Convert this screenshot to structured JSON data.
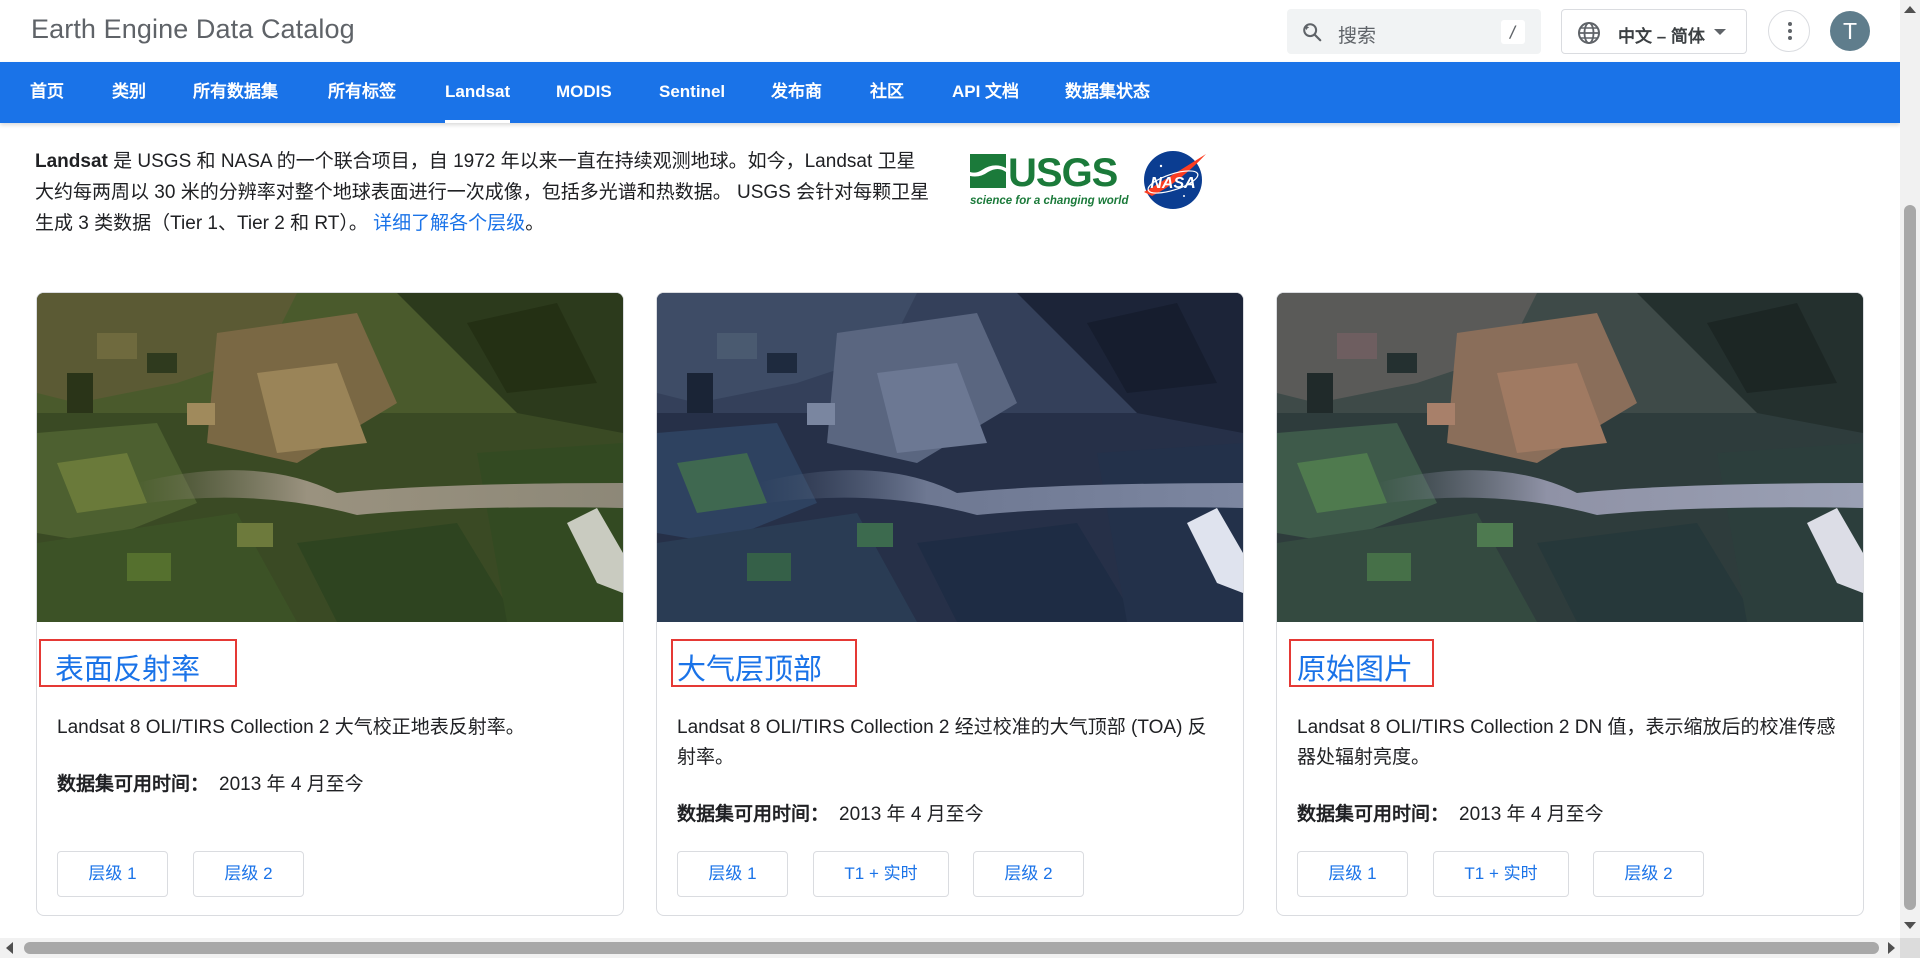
{
  "app": {
    "title": "Earth Engine Data Catalog"
  },
  "search": {
    "placeholder": "搜索",
    "shortcut": "/",
    "icon": "search-icon"
  },
  "language": {
    "label": "中文 – 简体",
    "icon": "globe-icon"
  },
  "more": {
    "icon": "more-vert-icon"
  },
  "avatar": {
    "initial": "T",
    "color": "#5f7d8c"
  },
  "nav": {
    "background": "#1a73e8",
    "tabs": [
      {
        "label": "首页",
        "active": false
      },
      {
        "label": "类别",
        "active": false
      },
      {
        "label": "所有数据集",
        "active": false
      },
      {
        "label": "所有标签",
        "active": false
      },
      {
        "label": "Landsat",
        "active": true
      },
      {
        "label": "MODIS",
        "active": false
      },
      {
        "label": "Sentinel",
        "active": false
      },
      {
        "label": "发布商",
        "active": false
      },
      {
        "label": "社区",
        "active": false
      },
      {
        "label": "API 文档",
        "active": false
      },
      {
        "label": "数据集状态",
        "active": false
      }
    ]
  },
  "intro": {
    "bold": "Landsat",
    "text": " 是 USGS 和 NASA 的一个联合项目，自 1972 年以来一直在持续观测地球。如今，Landsat 卫星大约每两周以 30 米的分辨率对整个地球表面进行一次成像，包括多光谱和热数据。 USGS 会针对每颗卫星生成 3 类数据（Tier 1、Tier 2 和 RT）。 ",
    "link": "详细了解各个层级",
    "tail": "。",
    "logos": {
      "usgs": "USGS",
      "usgs_tagline": "science for a changing world",
      "nasa": "NASA"
    }
  },
  "cards": [
    {
      "title": "表面反射率",
      "description": "Landsat 8 OLI/TIRS Collection 2 大气校正地表反射率。",
      "availability_label": "数据集可用时间：",
      "availability_value": "2013 年 4 月至今",
      "buttons": [
        "层级 1",
        "层级 2"
      ],
      "image": "satellite-image-surface-reflectance"
    },
    {
      "title": "大气层顶部",
      "description": "Landsat 8 OLI/TIRS Collection 2 经过校准的大气顶部 (TOA) 反射率。",
      "availability_label": "数据集可用时间：",
      "availability_value": "2013 年 4 月至今",
      "buttons": [
        "层级 1",
        "T1 + 实时",
        "层级 2"
      ],
      "image": "satellite-image-toa"
    },
    {
      "title": "原始图片",
      "description": "Landsat 8 OLI/TIRS Collection 2 DN 值，表示缩放后的校准传感器处辐射亮度。",
      "availability_label": "数据集可用时间：",
      "availability_value": "2013 年 4 月至今",
      "buttons": [
        "层级 1",
        "T1 + 实时",
        "层级 2"
      ],
      "image": "satellite-image-raw"
    }
  ],
  "colors": {
    "link": "#1a73e8",
    "title_highlight_border": "#e53935"
  }
}
